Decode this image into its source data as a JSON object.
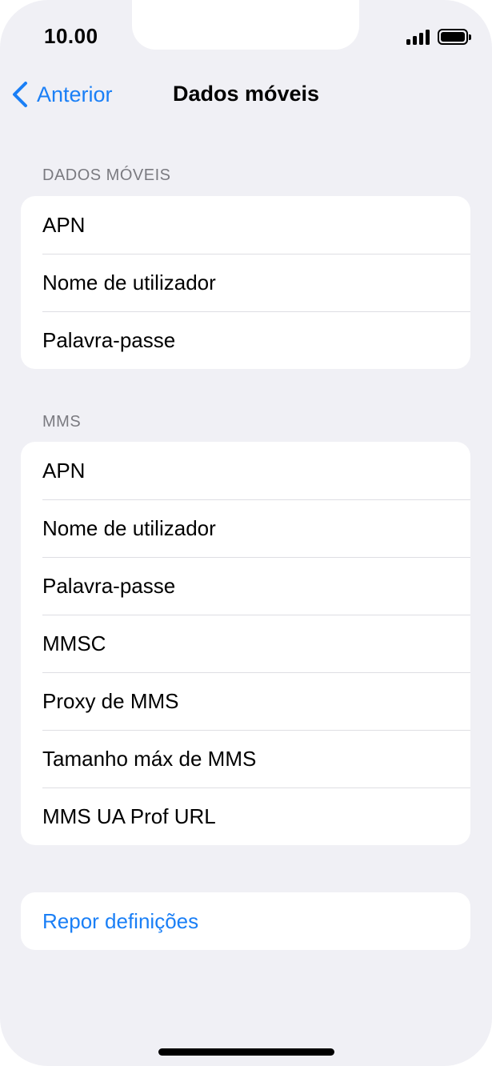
{
  "status_bar": {
    "time": "10.00"
  },
  "nav": {
    "back_label": "Anterior",
    "title": "Dados móveis"
  },
  "sections": {
    "dados_moveis": {
      "header": "DADOS MÓVEIS",
      "items": [
        "APN",
        "Nome de utilizador",
        "Palavra-passe"
      ]
    },
    "mms": {
      "header": "MMS",
      "items": [
        "APN",
        "Nome de utilizador",
        "Palavra-passe",
        "MMSC",
        "Proxy de MMS",
        "Tamanho máx de MMS",
        "MMS UA Prof URL"
      ]
    },
    "reset": {
      "label": "Repor definições"
    }
  },
  "colors": {
    "accent": "#1a7ff6",
    "background": "#f0f0f5",
    "section_header": "#7a7a80"
  }
}
